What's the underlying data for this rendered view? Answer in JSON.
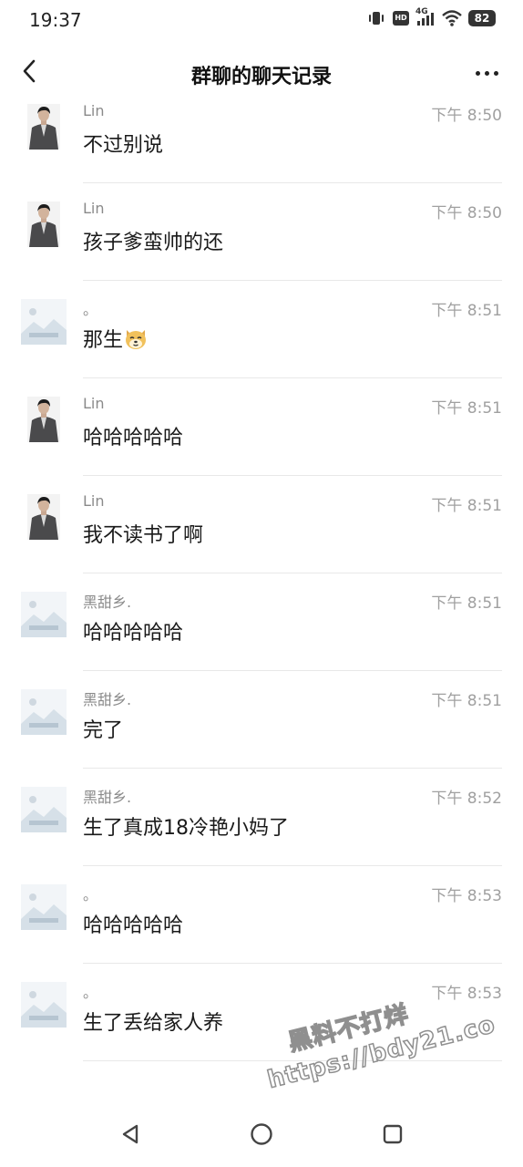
{
  "status_bar": {
    "time": "19:37",
    "network": "4G",
    "hd": "HD",
    "battery": "82"
  },
  "header": {
    "title": "群聊的聊天记录"
  },
  "messages": [
    {
      "sender": "Lin",
      "time": "下午 8:50",
      "text": "不过别说",
      "avatar": "person"
    },
    {
      "sender": "Lin",
      "time": "下午 8:50",
      "text": "孩子爹蛮帅的还",
      "avatar": "person"
    },
    {
      "sender": "。",
      "time": "下午 8:51",
      "text": "那生",
      "emoji": "dog-emoji",
      "avatar": "landscape"
    },
    {
      "sender": "Lin",
      "time": "下午 8:51",
      "text": "哈哈哈哈哈",
      "avatar": "person"
    },
    {
      "sender": "Lin",
      "time": "下午 8:51",
      "text": "我不读书了啊",
      "avatar": "person"
    },
    {
      "sender": "黑甜乡.",
      "time": "下午 8:51",
      "text": "哈哈哈哈哈",
      "avatar": "landscape"
    },
    {
      "sender": "黑甜乡.",
      "time": "下午 8:51",
      "text": "完了",
      "avatar": "landscape"
    },
    {
      "sender": "黑甜乡.",
      "time": "下午 8:52",
      "text": "生了真成18冷艳小妈了",
      "avatar": "landscape"
    },
    {
      "sender": "。",
      "time": "下午 8:53",
      "text": "哈哈哈哈哈",
      "avatar": "landscape"
    },
    {
      "sender": "。",
      "time": "下午 8:53",
      "text": "生了丢给家人养",
      "avatar": "landscape"
    }
  ],
  "watermark": {
    "line1": "黑料不打烊",
    "line2": "https://bdy21.co"
  },
  "colors": {
    "background": "#ffffff",
    "text_primary": "#1a1a1a",
    "text_secondary": "#8a8a8a",
    "divider": "#e8e8e8"
  }
}
